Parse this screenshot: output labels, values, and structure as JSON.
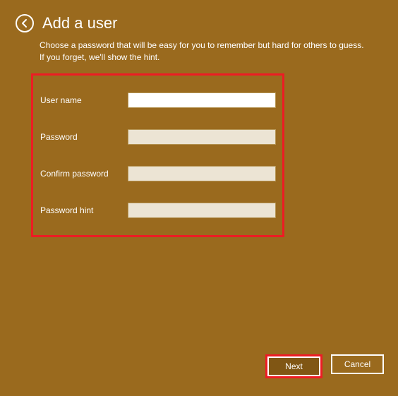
{
  "header": {
    "title": "Add a user",
    "subtitle": "Choose a password that will be easy for you to remember but hard for others to guess. If you forget, we'll show the hint."
  },
  "form": {
    "fields": [
      {
        "label": "User name",
        "value": "",
        "type": "text",
        "highlight": "white"
      },
      {
        "label": "Password",
        "value": "",
        "type": "password",
        "highlight": ""
      },
      {
        "label": "Confirm password",
        "value": "",
        "type": "password",
        "highlight": ""
      },
      {
        "label": "Password hint",
        "value": "",
        "type": "text",
        "highlight": ""
      }
    ]
  },
  "footer": {
    "next_label": "Next",
    "cancel_label": "Cancel"
  }
}
